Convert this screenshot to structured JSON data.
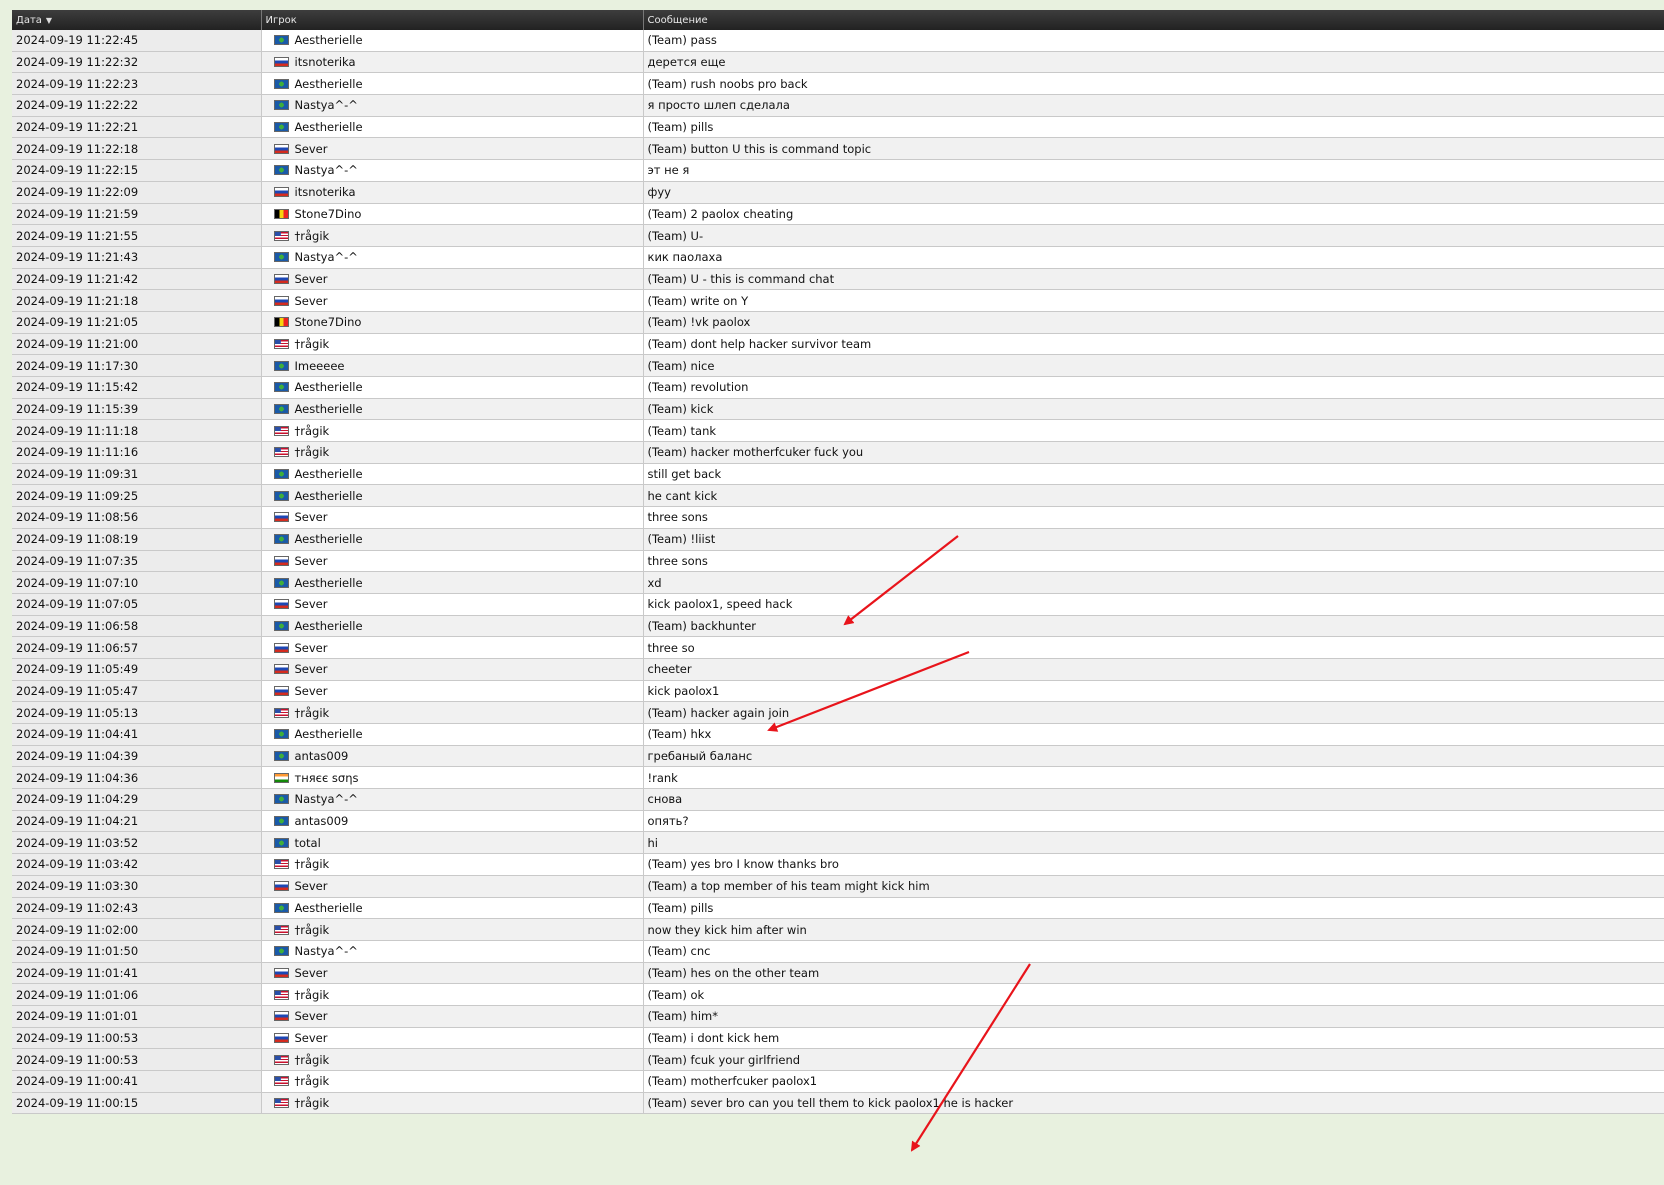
{
  "headers": {
    "date": "Дата",
    "player": "Игрок",
    "message": "Сообщение"
  },
  "rows": [
    {
      "date": "2024-09-19 11:22:45",
      "flag": "world",
      "player": "Aestherielle",
      "message": "(Team) pass"
    },
    {
      "date": "2024-09-19 11:22:32",
      "flag": "ru",
      "player": "itsnoterika",
      "message": "дерется еще"
    },
    {
      "date": "2024-09-19 11:22:23",
      "flag": "world",
      "player": "Aestherielle",
      "message": "(Team) rush noobs pro back"
    },
    {
      "date": "2024-09-19 11:22:22",
      "flag": "world",
      "player": "Nastya^-^",
      "message": "я просто шлеп сделала"
    },
    {
      "date": "2024-09-19 11:22:21",
      "flag": "world",
      "player": "Aestherielle",
      "message": "(Team) pills"
    },
    {
      "date": "2024-09-19 11:22:18",
      "flag": "ru",
      "player": "Sever",
      "message": "(Team) button U this is command topic"
    },
    {
      "date": "2024-09-19 11:22:15",
      "flag": "world",
      "player": "Nastya^-^",
      "message": "эт не я"
    },
    {
      "date": "2024-09-19 11:22:09",
      "flag": "ru",
      "player": "itsnoterika",
      "message": "фуу"
    },
    {
      "date": "2024-09-19 11:21:59",
      "flag": "be",
      "player": "Stone7Dino",
      "message": "(Team) 2 paolox cheating"
    },
    {
      "date": "2024-09-19 11:21:55",
      "flag": "us",
      "player": "†rågik",
      "message": "(Team) U-"
    },
    {
      "date": "2024-09-19 11:21:43",
      "flag": "world",
      "player": "Nastya^-^",
      "message": "кик паолаха"
    },
    {
      "date": "2024-09-19 11:21:42",
      "flag": "ru",
      "player": "Sever",
      "message": "(Team) U - this is command chat"
    },
    {
      "date": "2024-09-19 11:21:18",
      "flag": "ru",
      "player": "Sever",
      "message": "(Team) write on Y"
    },
    {
      "date": "2024-09-19 11:21:05",
      "flag": "be",
      "player": "Stone7Dino",
      "message": "(Team) !vk paolox"
    },
    {
      "date": "2024-09-19 11:21:00",
      "flag": "us",
      "player": "†rågik",
      "message": "(Team) dont help hacker survivor team"
    },
    {
      "date": "2024-09-19 11:17:30",
      "flag": "world",
      "player": "Imeeeee",
      "message": "(Team) nice"
    },
    {
      "date": "2024-09-19 11:15:42",
      "flag": "world",
      "player": "Aestherielle",
      "message": "(Team) revolution"
    },
    {
      "date": "2024-09-19 11:15:39",
      "flag": "world",
      "player": "Aestherielle",
      "message": "(Team) kick"
    },
    {
      "date": "2024-09-19 11:11:18",
      "flag": "us",
      "player": "†rågik",
      "message": "(Team) tank"
    },
    {
      "date": "2024-09-19 11:11:16",
      "flag": "us",
      "player": "†rågik",
      "message": "(Team) hacker motherfcuker fuck you"
    },
    {
      "date": "2024-09-19 11:09:31",
      "flag": "world",
      "player": "Aestherielle",
      "message": "still get back"
    },
    {
      "date": "2024-09-19 11:09:25",
      "flag": "world",
      "player": "Aestherielle",
      "message": "he cant kick"
    },
    {
      "date": "2024-09-19 11:08:56",
      "flag": "ru",
      "player": "Sever",
      "message": "three sons"
    },
    {
      "date": "2024-09-19 11:08:19",
      "flag": "world",
      "player": "Aestherielle",
      "message": "(Team) !liist"
    },
    {
      "date": "2024-09-19 11:07:35",
      "flag": "ru",
      "player": "Sever",
      "message": "three sons"
    },
    {
      "date": "2024-09-19 11:07:10",
      "flag": "world",
      "player": "Aestherielle",
      "message": "xd"
    },
    {
      "date": "2024-09-19 11:07:05",
      "flag": "ru",
      "player": "Sever",
      "message": "kick paolox1, speed hack"
    },
    {
      "date": "2024-09-19 11:06:58",
      "flag": "world",
      "player": "Aestherielle",
      "message": "(Team) backhunter"
    },
    {
      "date": "2024-09-19 11:06:57",
      "flag": "ru",
      "player": "Sever",
      "message": "three so"
    },
    {
      "date": "2024-09-19 11:05:49",
      "flag": "ru",
      "player": "Sever",
      "message": "cheeter"
    },
    {
      "date": "2024-09-19 11:05:47",
      "flag": "ru",
      "player": "Sever",
      "message": "kick paolox1"
    },
    {
      "date": "2024-09-19 11:05:13",
      "flag": "us",
      "player": "†rågik",
      "message": "(Team) hacker again join"
    },
    {
      "date": "2024-09-19 11:04:41",
      "flag": "world",
      "player": "Aestherielle",
      "message": "(Team) hkx"
    },
    {
      "date": "2024-09-19 11:04:39",
      "flag": "world",
      "player": "antas009",
      "message": "гребаный баланс"
    },
    {
      "date": "2024-09-19 11:04:36",
      "flag": "in",
      "player": "тняєє ѕσηѕ",
      "message": "!rank"
    },
    {
      "date": "2024-09-19 11:04:29",
      "flag": "world",
      "player": "Nastya^-^",
      "message": "снова"
    },
    {
      "date": "2024-09-19 11:04:21",
      "flag": "world",
      "player": "antas009",
      "message": "опять?"
    },
    {
      "date": "2024-09-19 11:03:52",
      "flag": "world",
      "player": "total",
      "message": "hi"
    },
    {
      "date": "2024-09-19 11:03:42",
      "flag": "us",
      "player": "†rågik",
      "message": "(Team) yes bro I know thanks bro"
    },
    {
      "date": "2024-09-19 11:03:30",
      "flag": "ru",
      "player": "Sever",
      "message": "(Team) a top member of his team might kick him"
    },
    {
      "date": "2024-09-19 11:02:43",
      "flag": "world",
      "player": "Aestherielle",
      "message": "(Team) pills"
    },
    {
      "date": "2024-09-19 11:02:00",
      "flag": "us",
      "player": "†rågik",
      "message": "now they kick him after win"
    },
    {
      "date": "2024-09-19 11:01:50",
      "flag": "world",
      "player": "Nastya^-^",
      "message": "(Team) cnc"
    },
    {
      "date": "2024-09-19 11:01:41",
      "flag": "ru",
      "player": "Sever",
      "message": "(Team) hes on the other team"
    },
    {
      "date": "2024-09-19 11:01:06",
      "flag": "us",
      "player": "†rågik",
      "message": "(Team) ok"
    },
    {
      "date": "2024-09-19 11:01:01",
      "flag": "ru",
      "player": "Sever",
      "message": "(Team) him*"
    },
    {
      "date": "2024-09-19 11:00:53",
      "flag": "ru",
      "player": "Sever",
      "message": "(Team) i dont kick hem"
    },
    {
      "date": "2024-09-19 11:00:53",
      "flag": "us",
      "player": "†rågik",
      "message": "(Team) fcuk your girlfriend"
    },
    {
      "date": "2024-09-19 11:00:41",
      "flag": "us",
      "player": "†rågik",
      "message": "(Team) motherfcuker paolox1"
    },
    {
      "date": "2024-09-19 11:00:15",
      "flag": "us",
      "player": "†rågik",
      "message": "(Team) sever bro can you tell them to kick paolox1 he is hacker"
    }
  ],
  "annotation_color": "#e8141b"
}
